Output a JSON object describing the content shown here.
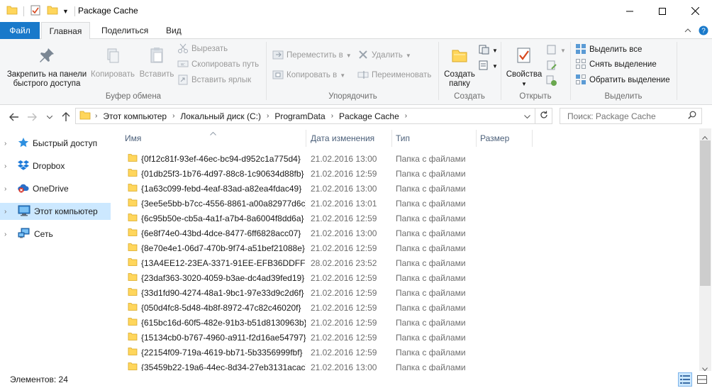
{
  "window": {
    "title": "Package Cache"
  },
  "ribbon_tabs": [
    {
      "label": "Файл"
    },
    {
      "label": "Главная"
    },
    {
      "label": "Поделиться"
    },
    {
      "label": "Вид"
    }
  ],
  "ribbon": {
    "clipboard": {
      "pin_label": "Закрепить на панели быстрого доступа",
      "pin_line1": "Закрепить на панели",
      "pin_line2": "быстрого доступа",
      "copy_label": "Копировать",
      "paste_label": "Вставить",
      "cut_label": "Вырезать",
      "copy_path_label": "Скопировать путь",
      "paste_shortcut_label": "Вставить ярлык",
      "group_label": "Буфер обмена"
    },
    "organize": {
      "move_to_label": "Переместить в",
      "copy_to_label": "Копировать в",
      "delete_label": "Удалить",
      "rename_label": "Переименовать",
      "group_label": "Упорядочить"
    },
    "new": {
      "new_folder_line1": "Создать",
      "new_folder_line2": "папку",
      "group_label": "Создать"
    },
    "open": {
      "properties_label": "Свойства",
      "group_label": "Открыть"
    },
    "select": {
      "select_all_label": "Выделить все",
      "select_none_label": "Снять выделение",
      "invert_label": "Обратить выделение",
      "group_label": "Выделить"
    }
  },
  "address": {
    "crumbs": [
      "Этот компьютер",
      "Локальный диск (C:)",
      "ProgramData",
      "Package Cache"
    ],
    "search_placeholder": "Поиск: Package Cache"
  },
  "nav_pane": [
    {
      "label": "Быстрый доступ",
      "icon": "star-icon",
      "selected": false
    },
    {
      "label": "Dropbox",
      "icon": "dropbox-icon",
      "selected": false
    },
    {
      "label": "OneDrive",
      "icon": "onedrive-icon",
      "selected": false
    },
    {
      "label": "Этот компьютер",
      "icon": "computer-icon",
      "selected": true
    },
    {
      "label": "Сеть",
      "icon": "network-icon",
      "selected": false
    }
  ],
  "columns": {
    "name": "Имя",
    "date": "Дата изменения",
    "type": "Тип",
    "size": "Размер"
  },
  "files": [
    {
      "name": "{0f12c81f-93ef-46ec-bc94-d952c1a775d4}",
      "date": "21.02.2016 13:00",
      "type": "Папка с файлами"
    },
    {
      "name": "{01db25f3-1b76-4d97-88c8-1c90634d88fb}",
      "date": "21.02.2016 12:59",
      "type": "Папка с файлами"
    },
    {
      "name": "{1a63c099-febd-4eaf-83ad-a82ea4fdac49}",
      "date": "21.02.2016 13:00",
      "type": "Папка с файлами"
    },
    {
      "name": "{3ee5e5bb-b7cc-4556-8861-a00a82977d6c}",
      "date": "21.02.2016 13:01",
      "type": "Папка с файлами"
    },
    {
      "name": "{6c95b50e-cb5a-4a1f-a7b4-8a6004f8dd6a}",
      "date": "21.02.2016 12:59",
      "type": "Папка с файлами"
    },
    {
      "name": "{6e8f74e0-43bd-4dce-8477-6ff6828acc07}",
      "date": "21.02.2016 13:00",
      "type": "Папка с файлами"
    },
    {
      "name": "{8e70e4e1-06d7-470b-9f74-a51bef21088e}",
      "date": "21.02.2016 12:59",
      "type": "Папка с файлами"
    },
    {
      "name": "{13A4EE12-23EA-3371-91EE-EFB36DDFFF…",
      "date": "28.02.2016 23:52",
      "type": "Папка с файлами"
    },
    {
      "name": "{23daf363-3020-4059-b3ae-dc4ad39fed19}",
      "date": "21.02.2016 12:59",
      "type": "Папка с файлами"
    },
    {
      "name": "{33d1fd90-4274-48a1-9bc1-97e33d9c2d6f}",
      "date": "21.02.2016 12:59",
      "type": "Папка с файлами"
    },
    {
      "name": "{050d4fc8-5d48-4b8f-8972-47c82c46020f}",
      "date": "21.02.2016 12:59",
      "type": "Папка с файлами"
    },
    {
      "name": "{615bc16d-60f5-482e-91b3-b51d8130963b}",
      "date": "21.02.2016 12:59",
      "type": "Папка с файлами"
    },
    {
      "name": "{15134cb0-b767-4960-a911-f2d16ae54797}",
      "date": "21.02.2016 12:59",
      "type": "Папка с файлами"
    },
    {
      "name": "{22154f09-719a-4619-bb71-5b3356999fbf}",
      "date": "21.02.2016 12:59",
      "type": "Папка с файлами"
    },
    {
      "name": "{35459b22-19a6-44ec-8d34-27eb3131acac}",
      "date": "21.02.2016 13:00",
      "type": "Папка с файлами"
    }
  ],
  "status": {
    "count_text": "Элементов: 24"
  },
  "colors": {
    "accent": "#1979ca",
    "selected_bg": "#cce8ff",
    "folder": "#ffd65c"
  }
}
